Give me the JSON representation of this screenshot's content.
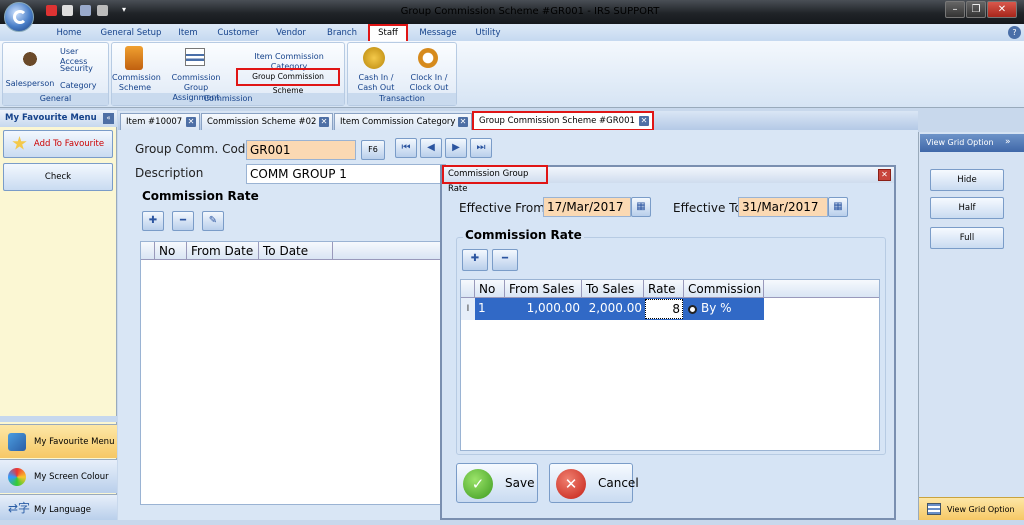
{
  "window": {
    "title": "Group Commission Scheme #GR001 - IRS SUPPORT"
  },
  "ribbon_tabs": [
    "Home",
    "General Setup",
    "Item",
    "Customer",
    "Vendor",
    "Branch",
    "Staff",
    "Message",
    "Utility"
  ],
  "ribbon": {
    "general_group": {
      "label": "General",
      "salesperson": "Salesperson",
      "user_access": "User Access",
      "security": "Security",
      "category": "Category"
    },
    "commission_group": {
      "label": "Commission",
      "commission_scheme": "Commission\nScheme",
      "group_assignment": "Commission Group\nAssignment",
      "item_commission_category": "Item Commission Category",
      "group_commission_scheme": "Group Commission Scheme"
    },
    "transaction_group": {
      "label": "Transaction",
      "cash_in_out": "Cash In /\nCash Out",
      "clock_in_out": "Clock In /\nClock Out"
    }
  },
  "left_panel": {
    "title": "My Favourite Menu",
    "add_favourite": "Add To Favourite",
    "check": "Check",
    "nav": [
      "My Favourite Menu",
      "My Screen Colour",
      "My Language"
    ]
  },
  "doc_tabs": [
    "Item #10007",
    "Commission Scheme #02",
    "Item Commission Category",
    "Group Commission Scheme #GR001"
  ],
  "form": {
    "group_code_label": "Group Comm. Code",
    "group_code_value": "GR001",
    "f6": "F6",
    "description_label": "Description",
    "description_value": "COMM GROUP 1",
    "commission_rate_title": "Commission Rate",
    "grid_headers": [
      "No",
      "From Date",
      "To Date"
    ]
  },
  "right_panel": {
    "title": "View Grid Option",
    "hide": "Hide",
    "half": "Half",
    "full": "Full",
    "bottom": "View Grid Option"
  },
  "dialog": {
    "title": "Commission Group Rate",
    "effective_from_label": "Effective From",
    "effective_from": "17/Mar/2017",
    "effective_to_label": "Effective To",
    "effective_to": "31/Mar/2017",
    "commission_rate_title": "Commission Rate",
    "grid_headers": [
      "No",
      "From Sales",
      "To Sales",
      "Rate",
      "Commission"
    ],
    "rows": [
      {
        "no": "1",
        "from_sales": "1,000.00",
        "to_sales": "2,000.00",
        "rate": "8",
        "commission": "By %"
      }
    ],
    "save": "Save",
    "cancel": "Cancel"
  }
}
